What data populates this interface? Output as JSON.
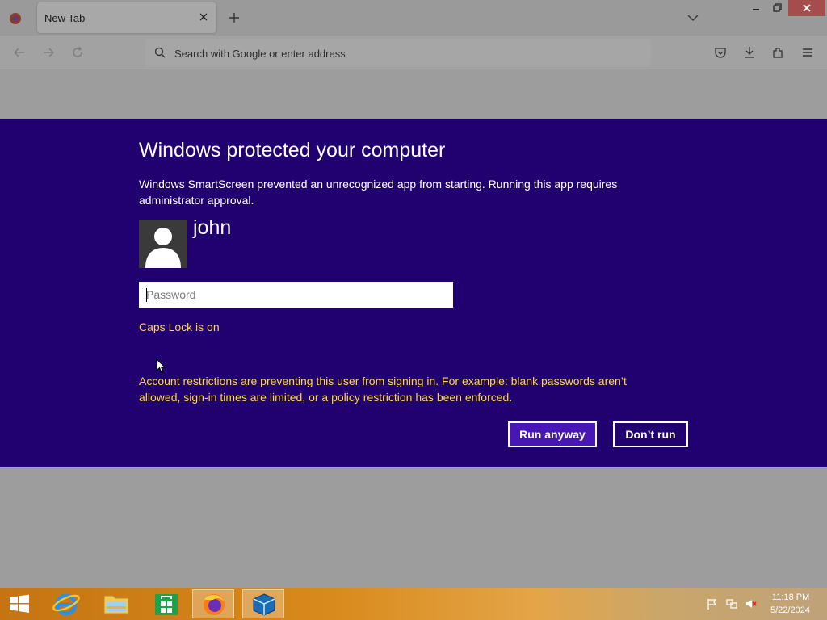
{
  "browser": {
    "tab_title": "New Tab",
    "url_placeholder": "Search with Google or enter address"
  },
  "dialog": {
    "title": "Windows protected your computer",
    "message": "Windows SmartScreen prevented an unrecognized app from starting. Running this app requires administrator approval.",
    "username": "john",
    "password_placeholder": "Password",
    "caps_lock": "Caps Lock is on",
    "restriction": "Account restrictions are preventing this user from signing in. For example: blank passwords aren’t allowed, sign-in times are limited, or a policy restriction has been enforced.",
    "run_anyway_label": "Run anyway",
    "dont_run_label": "Don’t run",
    "colors": {
      "background": "#21006f",
      "accent_button": "#4617b4",
      "warning_text": "#ffd83a"
    }
  },
  "taskbar": {
    "apps": [
      "internet-explorer",
      "file-explorer",
      "store",
      "firefox",
      "virtualbox"
    ],
    "clock_time": "11:18 PM",
    "clock_date": "5/22/2024"
  }
}
